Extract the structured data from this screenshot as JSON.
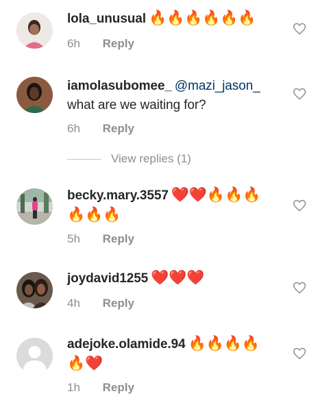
{
  "comments": [
    {
      "username": "lola_unusual",
      "mention": "",
      "text": "",
      "emojis_line1": "🔥🔥🔥🔥🔥🔥",
      "emojis_line2": "",
      "time": "6h",
      "reply_label": "Reply",
      "avatar": "woman-portrait-avatar"
    },
    {
      "username": "iamolasubomee_",
      "mention": "@mazi_jason_",
      "text": "what are we waiting for?",
      "emojis_line1": "",
      "emojis_line2": "",
      "time": "6h",
      "reply_label": "Reply",
      "avatar": "woman-portrait-avatar"
    },
    {
      "username": "becky.mary.3557",
      "mention": "",
      "text": "",
      "emojis_line1": "❤️❤️🔥🔥🔥",
      "emojis_line2": "🔥🔥🔥",
      "time": "5h",
      "reply_label": "Reply",
      "avatar": "outdoor-photo-avatar"
    },
    {
      "username": "joydavid1255",
      "mention": "",
      "text": "",
      "emojis_line1": "❤️❤️❤️",
      "emojis_line2": "",
      "time": "4h",
      "reply_label": "Reply",
      "avatar": "two-people-avatar"
    },
    {
      "username": "adejoke.olamide.94",
      "mention": "",
      "text": "",
      "emojis_line1": "🔥🔥🔥🔥",
      "emojis_line2": "🔥❤️",
      "time": "1h",
      "reply_label": "Reply",
      "avatar": "default-avatar"
    }
  ],
  "view_replies": "View replies (1)",
  "colors": {
    "username": "#262626",
    "mention": "#003569",
    "meta": "#8e8e8e",
    "heart_outline": "#8e8e8e"
  }
}
